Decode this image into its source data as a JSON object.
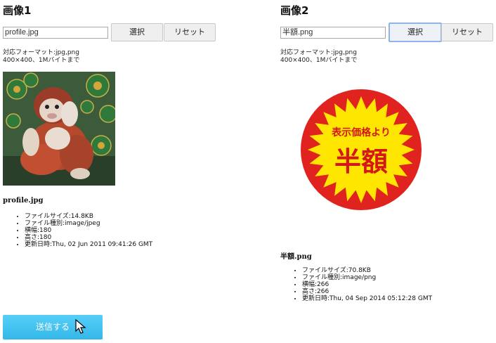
{
  "columns": [
    {
      "title": "画像1",
      "file_value": "profile.jpg",
      "select_label": "選択",
      "reset_label": "リセット",
      "hint_line1": "対応フォーマット:jpg,png",
      "hint_line2": "400×400、1Mバイトまで",
      "file_name": "profile.jpg",
      "info": [
        "ファイルサイズ:14.8KB",
        "ファイル種別:image/jpeg",
        "横幅:180",
        "高さ:180",
        "更新日時:Thu, 02 Jun 2011 09:41:26 GMT"
      ]
    },
    {
      "title": "画像2",
      "file_value": "半額.png",
      "select_label": "選択",
      "reset_label": "リセット",
      "hint_line1": "対応フォーマット:jpg,png",
      "hint_line2": "400×400、1Mバイトまで",
      "file_name": "半額.png",
      "info": [
        "ファイルサイズ:70.8KB",
        "ファイル種別:image/png",
        "横幅:266",
        "高さ:266",
        "更新日時:Thu, 04 Sep 2014 05:12:28 GMT"
      ],
      "sticker": {
        "top_text": "表示価格より",
        "main_text": "半額",
        "outer_color": "#e0231f",
        "star_color": "#ffe600"
      }
    }
  ],
  "submit_label": "送信する",
  "thumb1_icon": "monkey-statue-photo",
  "cursor_icon": "mouse-pointer-icon",
  "colors": {
    "submit_bg": "#3fc0f0",
    "focus_border": "#8fb4e8"
  }
}
